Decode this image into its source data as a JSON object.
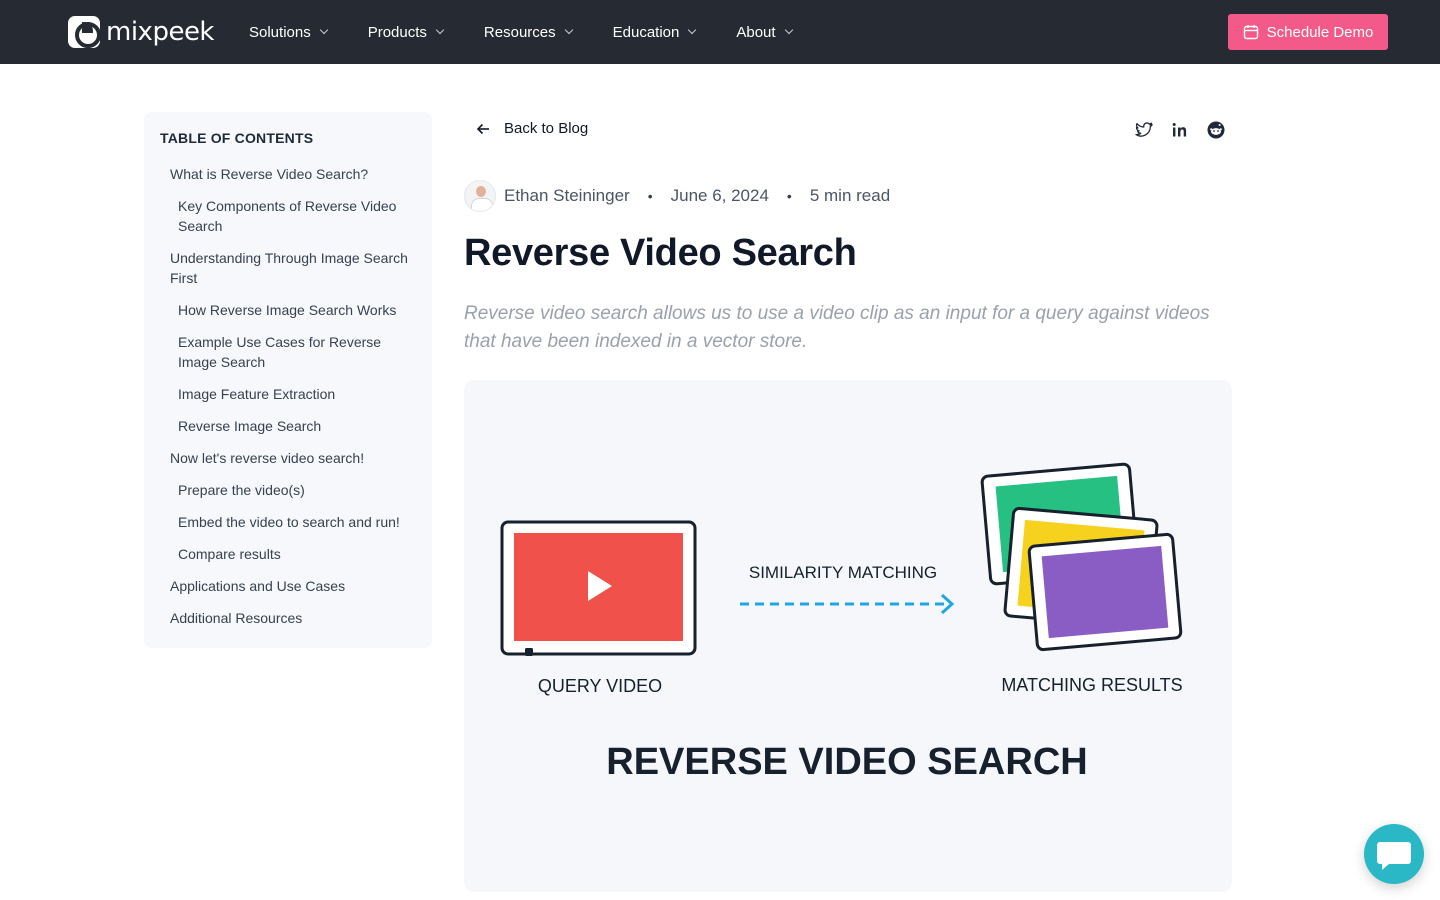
{
  "header": {
    "logo_text": "mixpeek",
    "nav": [
      {
        "label": "Solutions"
      },
      {
        "label": "Products"
      },
      {
        "label": "Resources"
      },
      {
        "label": "Education"
      },
      {
        "label": "About"
      }
    ],
    "cta_label": "Schedule Demo",
    "cta_color": "#f35a8a",
    "background": "#252a33"
  },
  "toc": {
    "title": "TABLE OF CONTENTS",
    "items": [
      {
        "label": "What is Reverse Video Search?",
        "level": 1
      },
      {
        "label": "Key Components of Reverse Video Search",
        "level": 2
      },
      {
        "label": "Understanding Through Image Search First",
        "level": 1
      },
      {
        "label": "How Reverse Image Search Works",
        "level": 2
      },
      {
        "label": "Example Use Cases for Reverse Image Search",
        "level": 2
      },
      {
        "label": "Image Feature Extraction",
        "level": 2
      },
      {
        "label": "Reverse Image Search",
        "level": 2
      },
      {
        "label": "Now let's reverse video search!",
        "level": 1
      },
      {
        "label": "Prepare the video(s)",
        "level": 2
      },
      {
        "label": "Embed the video to search and run!",
        "level": 2
      },
      {
        "label": "Compare results",
        "level": 2
      },
      {
        "label": "Applications and Use Cases",
        "level": 1
      },
      {
        "label": "Additional Resources",
        "level": 1
      }
    ]
  },
  "post": {
    "back_label": "Back to Blog",
    "share_icons": [
      "twitter-icon",
      "linkedin-icon",
      "reddit-icon"
    ],
    "author": "Ethan Steininger",
    "date": "June 6, 2024",
    "read_time": "5 min read",
    "separator": "•",
    "title": "Reverse Video Search",
    "excerpt": "Reverse video search allows us to use a video clip as an input for a query against videos that have been indexed in a vector store."
  },
  "hero": {
    "query_label": "QUERY VIDEO",
    "matching_label": "SIMILARITY MATCHING",
    "results_label": "MATCHING RESULTS",
    "headline": "REVERSE VIDEO SEARCH",
    "colors": {
      "video": "#f0514a",
      "arrow": "#1ea7e4",
      "card_green": "#26c083",
      "card_yellow": "#f6d21f",
      "card_purple": "#8a5dc4",
      "ink": "#17202d"
    }
  },
  "chat_widget": {
    "icon": "chat-bubble-icon",
    "color": "#2ab7c6"
  }
}
